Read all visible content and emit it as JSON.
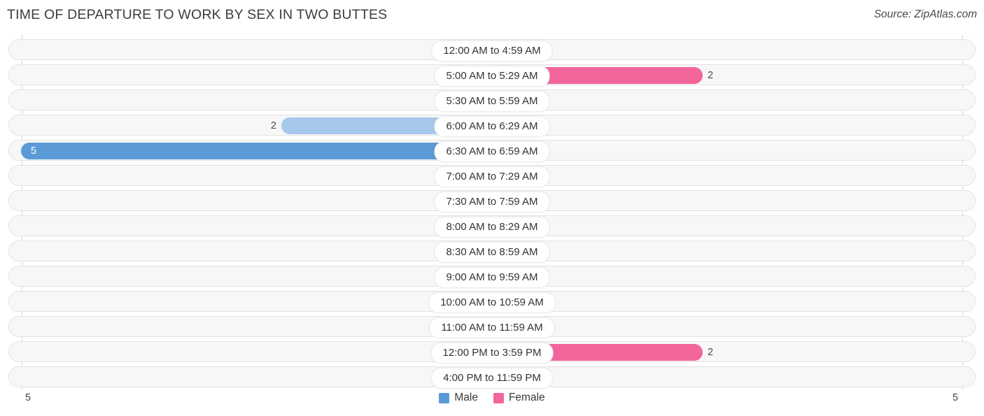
{
  "header": {
    "title": "TIME OF DEPARTURE TO WORK BY SEX IN TWO BUTTES",
    "source": "Source: ZipAtlas.com"
  },
  "axis": {
    "left_end": "5",
    "right_end": "5"
  },
  "legend": {
    "items": [
      {
        "label": "Male",
        "color": "#5b9bd5"
      },
      {
        "label": "Female",
        "color": "#f2669b"
      }
    ]
  },
  "colors": {
    "male_light": "#a6c8ec",
    "male_dark": "#5b9bd5",
    "female_light": "#f9aecb",
    "female_dark": "#f2669b",
    "row_track": "#f7f7f7",
    "row_border": "#e3e3e3",
    "gridline": "#d8d8d8"
  },
  "chart_data": {
    "type": "bar",
    "orientation": "horizontal",
    "style": "diverging-bidirectional",
    "title": "TIME OF DEPARTURE TO WORK BY SEX IN TWO BUTTES",
    "xlabel": "",
    "ylabel": "",
    "xlim": [
      5,
      0,
      5
    ],
    "axis_left_max": 5,
    "axis_right_max": 5,
    "grid": true,
    "legend_position": "bottom-center",
    "categories": [
      "12:00 AM to 4:59 AM",
      "5:00 AM to 5:29 AM",
      "5:30 AM to 5:59 AM",
      "6:00 AM to 6:29 AM",
      "6:30 AM to 6:59 AM",
      "7:00 AM to 7:29 AM",
      "7:30 AM to 7:59 AM",
      "8:00 AM to 8:29 AM",
      "8:30 AM to 8:59 AM",
      "9:00 AM to 9:59 AM",
      "10:00 AM to 10:59 AM",
      "11:00 AM to 11:59 AM",
      "12:00 PM to 3:59 PM",
      "4:00 PM to 11:59 PM"
    ],
    "series": [
      {
        "name": "Male",
        "side": "left",
        "values": [
          0,
          0,
          0,
          2,
          5,
          0,
          0,
          0,
          0,
          0,
          0,
          0,
          0,
          0
        ],
        "labels": [
          "0",
          "0",
          "0",
          "2",
          "5",
          "0",
          "0",
          "0",
          "0",
          "0",
          "0",
          "0",
          "0",
          "0"
        ]
      },
      {
        "name": "Female",
        "side": "right",
        "values": [
          0,
          2,
          0,
          0,
          0,
          0,
          0,
          0,
          0,
          0,
          0,
          0,
          2,
          0
        ],
        "labels": [
          "0",
          "2",
          "0",
          "0",
          "0",
          "0",
          "0",
          "0",
          "0",
          "0",
          "0",
          "0",
          "2",
          "0"
        ]
      }
    ]
  }
}
